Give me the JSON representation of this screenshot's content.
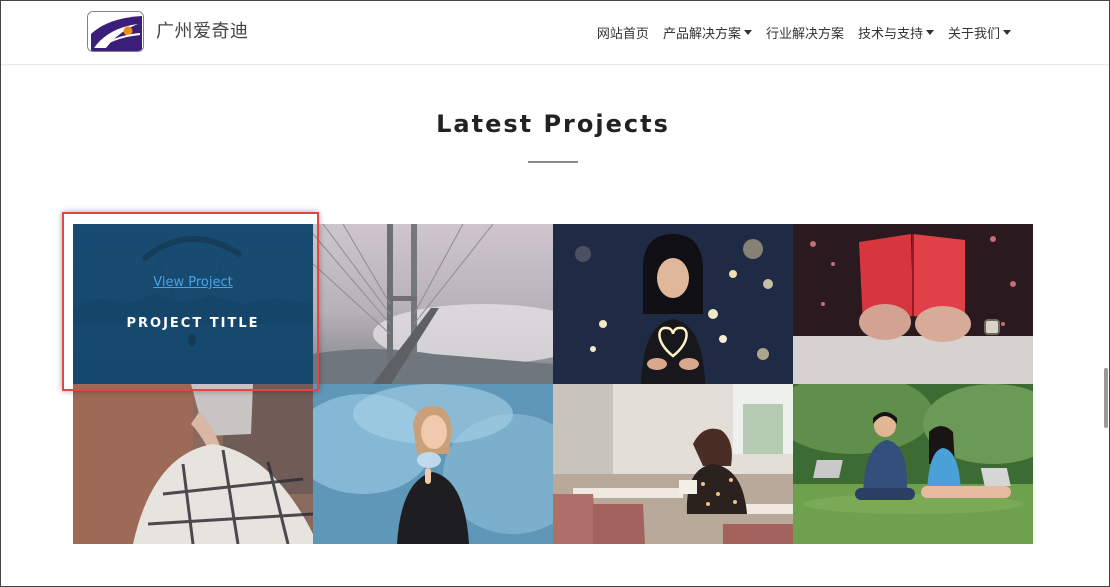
{
  "header": {
    "brand_name": "广州爱奇迪",
    "logo_icon": "company-logo-icon",
    "nav": [
      {
        "label": "网站首页",
        "dropdown": false
      },
      {
        "label": "产品解决方案",
        "dropdown": true
      },
      {
        "label": "行业解决方案",
        "dropdown": false
      },
      {
        "label": "技术与支持",
        "dropdown": true
      },
      {
        "label": "关于我们",
        "dropdown": true
      }
    ]
  },
  "section": {
    "title": "Latest Projects"
  },
  "hovered_project": {
    "link_label": "View Project",
    "title": "PROJECT TITLE"
  },
  "projects": [
    {
      "subject": "paraglider over mountains at dusk"
    },
    {
      "subject": "suspension bridge in fog"
    },
    {
      "subject": "girl holding heart-shaped lights"
    },
    {
      "subject": "hands holding a red book"
    },
    {
      "subject": "hands holding a plaid bag"
    },
    {
      "subject": "woman in blue smoke"
    },
    {
      "subject": "woman reading in a cafe"
    },
    {
      "subject": "couple with laptops on grass"
    }
  ],
  "colors": {
    "overlay": "#14486c",
    "link": "#4aa3e6",
    "highlight_border": "#e04848",
    "logo_purple": "#3a1e7a",
    "logo_orange": "#f08a1a"
  }
}
